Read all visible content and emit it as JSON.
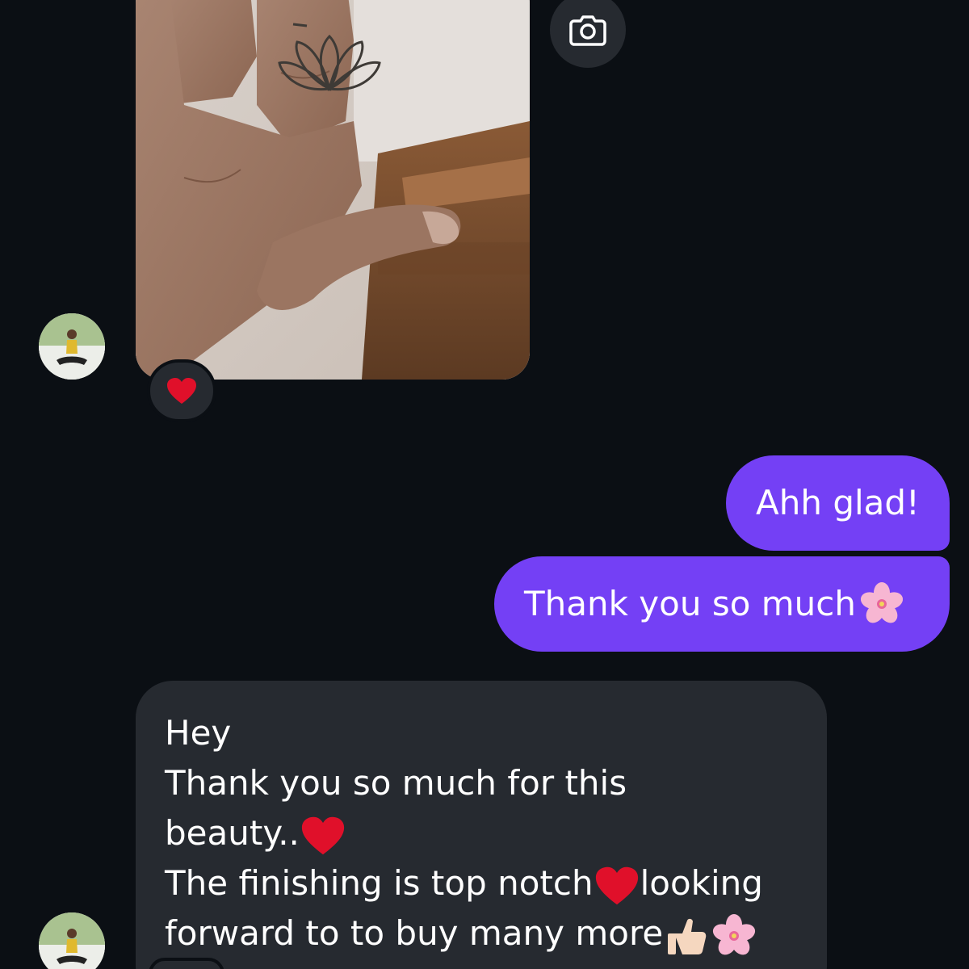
{
  "thread": {
    "photo_message": {
      "image_description_icon": "photo-of-hand-wearing-lotus-ring",
      "reaction": "❤️",
      "camera_icon": "camera-icon"
    },
    "outgoing": [
      {
        "text": "Ahh glad!"
      },
      {
        "text": "Thank you so much",
        "emoji": "🌸"
      }
    ],
    "incoming_text": {
      "line1": "Hey",
      "line2": "Thank you so much for this",
      "line3": "beauty..",
      "line3_emoji": "❤️",
      "line4_a": "The finishing is top notch",
      "line4_emoji": "❤️",
      "line4_b": "looking",
      "line5": "forward to to buy many more",
      "line5_emoji_1": "👍🏻",
      "line5_emoji_2": "🌸"
    }
  },
  "colors": {
    "background": "#0b0f14",
    "outgoing_bubble": "#7440f5",
    "incoming_bubble": "#262a30",
    "text": "#ffffff"
  }
}
